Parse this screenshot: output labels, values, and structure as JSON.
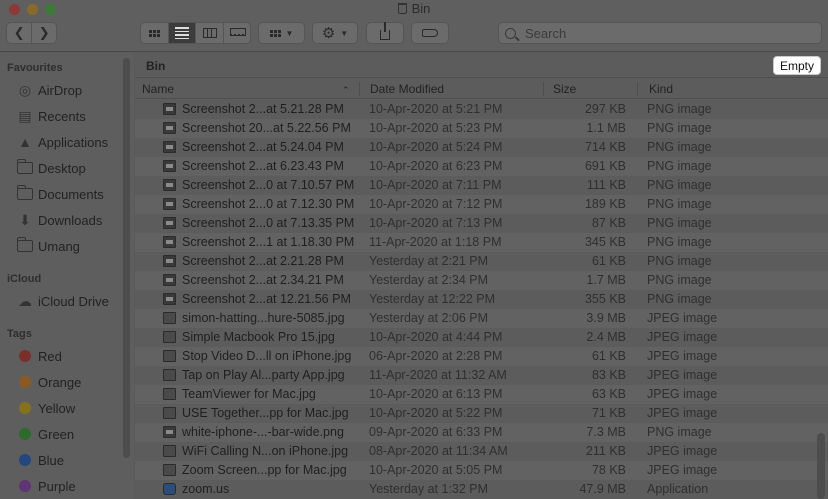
{
  "window": {
    "title": "Bin"
  },
  "toolbar": {
    "back_icon": "chevron-left-icon",
    "forward_icon": "chevron-right-icon",
    "view_modes": [
      "icon-view",
      "list-view",
      "column-view",
      "gallery-view"
    ],
    "active_view": "list-view",
    "search_placeholder": "Search"
  },
  "sidebar": {
    "favourites_heading": "Favourites",
    "favourites": [
      {
        "label": "AirDrop",
        "icon": "airdrop-icon"
      },
      {
        "label": "Recents",
        "icon": "recents-icon"
      },
      {
        "label": "Applications",
        "icon": "applications-icon"
      },
      {
        "label": "Desktop",
        "icon": "desktop-icon"
      },
      {
        "label": "Documents",
        "icon": "documents-icon"
      },
      {
        "label": "Downloads",
        "icon": "downloads-icon"
      },
      {
        "label": "Umang",
        "icon": "folder-icon"
      }
    ],
    "icloud_heading": "iCloud",
    "icloud": [
      {
        "label": "iCloud Drive",
        "icon": "cloud-icon"
      }
    ],
    "tags_heading": "Tags",
    "tags": [
      {
        "label": "Red",
        "color": "#7a2f2c"
      },
      {
        "label": "Orange",
        "color": "#8a5a24"
      },
      {
        "label": "Yellow",
        "color": "#857220"
      },
      {
        "label": "Green",
        "color": "#2e6a2c"
      },
      {
        "label": "Blue",
        "color": "#24477e"
      },
      {
        "label": "Purple",
        "color": "#5e3474"
      }
    ]
  },
  "main": {
    "path_label": "Bin",
    "empty_button": "Empty",
    "columns": {
      "name": "Name",
      "date": "Date Modified",
      "size": "Size",
      "kind": "Kind"
    },
    "rows": [
      {
        "name": "Screenshot 2...at 5.21.28 PM",
        "date": "10-Apr-2020 at 5:21 PM",
        "size": "297 KB",
        "kind": "PNG image",
        "type": "png"
      },
      {
        "name": "Screenshot 20...at 5.22.56 PM",
        "date": "10-Apr-2020 at 5:23 PM",
        "size": "1.1 MB",
        "kind": "PNG image",
        "type": "png"
      },
      {
        "name": "Screenshot 2...at 5.24.04 PM",
        "date": "10-Apr-2020 at 5:24 PM",
        "size": "714 KB",
        "kind": "PNG image",
        "type": "png"
      },
      {
        "name": "Screenshot 2...at 6.23.43 PM",
        "date": "10-Apr-2020 at 6:23 PM",
        "size": "691 KB",
        "kind": "PNG image",
        "type": "png"
      },
      {
        "name": "Screenshot 2...0 at 7.10.57 PM",
        "date": "10-Apr-2020 at 7:11 PM",
        "size": "111 KB",
        "kind": "PNG image",
        "type": "png"
      },
      {
        "name": "Screenshot 2...0 at 7.12.30 PM",
        "date": "10-Apr-2020 at 7:12 PM",
        "size": "189 KB",
        "kind": "PNG image",
        "type": "png"
      },
      {
        "name": "Screenshot 2...0 at 7.13.35 PM",
        "date": "10-Apr-2020 at 7:13 PM",
        "size": "87 KB",
        "kind": "PNG image",
        "type": "png"
      },
      {
        "name": "Screenshot 2...1 at 1.18.30 PM",
        "date": "11-Apr-2020 at 1:18 PM",
        "size": "345 KB",
        "kind": "PNG image",
        "type": "png"
      },
      {
        "name": "Screenshot 2...at 2.21.28 PM",
        "date": "Yesterday at 2:21 PM",
        "size": "61 KB",
        "kind": "PNG image",
        "type": "png"
      },
      {
        "name": "Screenshot 2...at 2.34.21 PM",
        "date": "Yesterday at 2:34 PM",
        "size": "1.7 MB",
        "kind": "PNG image",
        "type": "png"
      },
      {
        "name": "Screenshot 2...at 12.21.56 PM",
        "date": "Yesterday at 12:22 PM",
        "size": "355 KB",
        "kind": "PNG image",
        "type": "png"
      },
      {
        "name": "simon-hatting...hure-5085.jpg",
        "date": "Yesterday at 2:06 PM",
        "size": "3.9 MB",
        "kind": "JPEG image",
        "type": "jpg"
      },
      {
        "name": "Simple Macbook Pro 15.jpg",
        "date": "10-Apr-2020 at 4:44 PM",
        "size": "2.4 MB",
        "kind": "JPEG image",
        "type": "jpg"
      },
      {
        "name": "Stop Video D...ll on iPhone.jpg",
        "date": "06-Apr-2020 at 2:28 PM",
        "size": "61 KB",
        "kind": "JPEG image",
        "type": "jpg"
      },
      {
        "name": "Tap on Play Al...party App.jpg",
        "date": "11-Apr-2020 at 11:32 AM",
        "size": "83 KB",
        "kind": "JPEG image",
        "type": "jpg"
      },
      {
        "name": "TeamViewer for Mac.jpg",
        "date": "10-Apr-2020 at 6:13 PM",
        "size": "63 KB",
        "kind": "JPEG image",
        "type": "jpg"
      },
      {
        "name": "USE Together...pp for Mac.jpg",
        "date": "10-Apr-2020 at 5:22 PM",
        "size": "71 KB",
        "kind": "JPEG image",
        "type": "jpg"
      },
      {
        "name": "white-iphone-...-bar-wide.png",
        "date": "09-Apr-2020 at 6:33 PM",
        "size": "7.3 MB",
        "kind": "PNG image",
        "type": "png"
      },
      {
        "name": "WiFi Calling N...on iPhone.jpg",
        "date": "08-Apr-2020 at 11:34 AM",
        "size": "211 KB",
        "kind": "JPEG image",
        "type": "jpg"
      },
      {
        "name": "Zoom Screen...pp for Mac.jpg",
        "date": "10-Apr-2020 at 5:05 PM",
        "size": "78 KB",
        "kind": "JPEG image",
        "type": "jpg"
      },
      {
        "name": "zoom.us",
        "date": "Yesterday at 1:32 PM",
        "size": "47.9 MB",
        "kind": "Application",
        "type": "app"
      }
    ]
  }
}
